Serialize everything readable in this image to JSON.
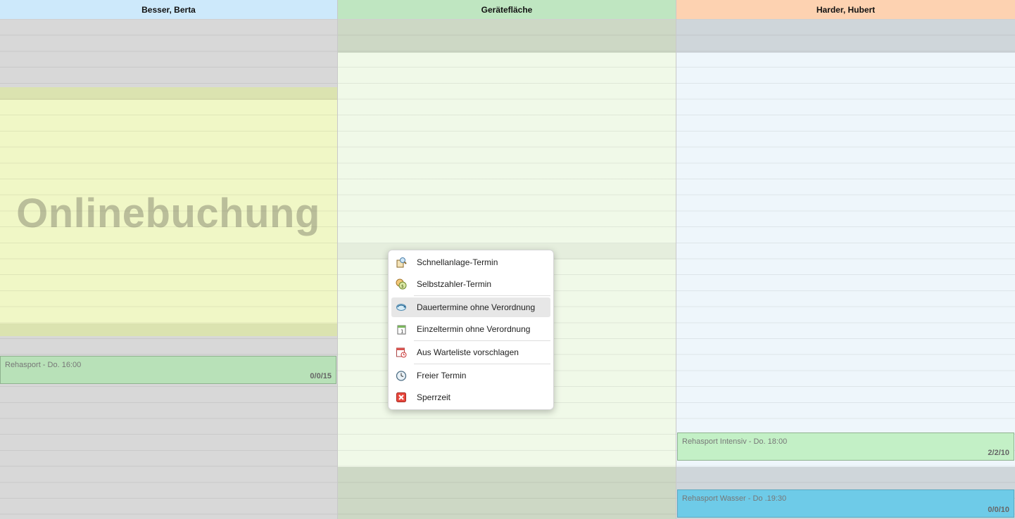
{
  "columns": [
    {
      "name": "Besser, Berta",
      "header_color": "#cde9fb"
    },
    {
      "name": "Gerätefläche",
      "header_color": "#bfe6c1"
    },
    {
      "name": "Harder, Hubert",
      "header_color": "#fdd2b1"
    }
  ],
  "watermark": "Onlinebuchung",
  "events": [
    {
      "title": "Rehasport - Do. 16:00",
      "count": "0/0/15",
      "color": "#b8e1b8"
    },
    {
      "title": "Rehasport Intensiv - Do. 18:00",
      "count": "2/2/10",
      "color": "#c3f0c6"
    },
    {
      "title": "Rehasport Wasser - Do .19:30",
      "count": "0/0/10",
      "color": "#6ecbe8"
    }
  ],
  "context_menu": {
    "items": [
      {
        "label": "Schnellanlage-Termin",
        "icon": "quick-create-icon"
      },
      {
        "label": "Selbstzahler-Termin",
        "icon": "coins-icon"
      },
      {
        "label": "Dauertermine ohne Verordnung",
        "icon": "recurring-icon"
      },
      {
        "label": "Einzeltermin ohne Verordnung",
        "icon": "single-date-icon"
      },
      {
        "label": "Aus Warteliste vorschlagen",
        "icon": "waitlist-icon"
      },
      {
        "label": "Freier Termin",
        "icon": "clock-icon"
      },
      {
        "label": "Sperrzeit",
        "icon": "block-icon"
      }
    ],
    "hovered_index": 2
  },
  "colors": {
    "unavailable_gray": "#d8d8d8",
    "online_yellow": "#f0f7c6",
    "online_edge": "#dbe3b0",
    "equipment_green": "#f0f9e8",
    "equipment_gray": "#cdd8c5",
    "hubert_blue": "#eef6fb",
    "hubert_gray": "#cfd6da"
  }
}
